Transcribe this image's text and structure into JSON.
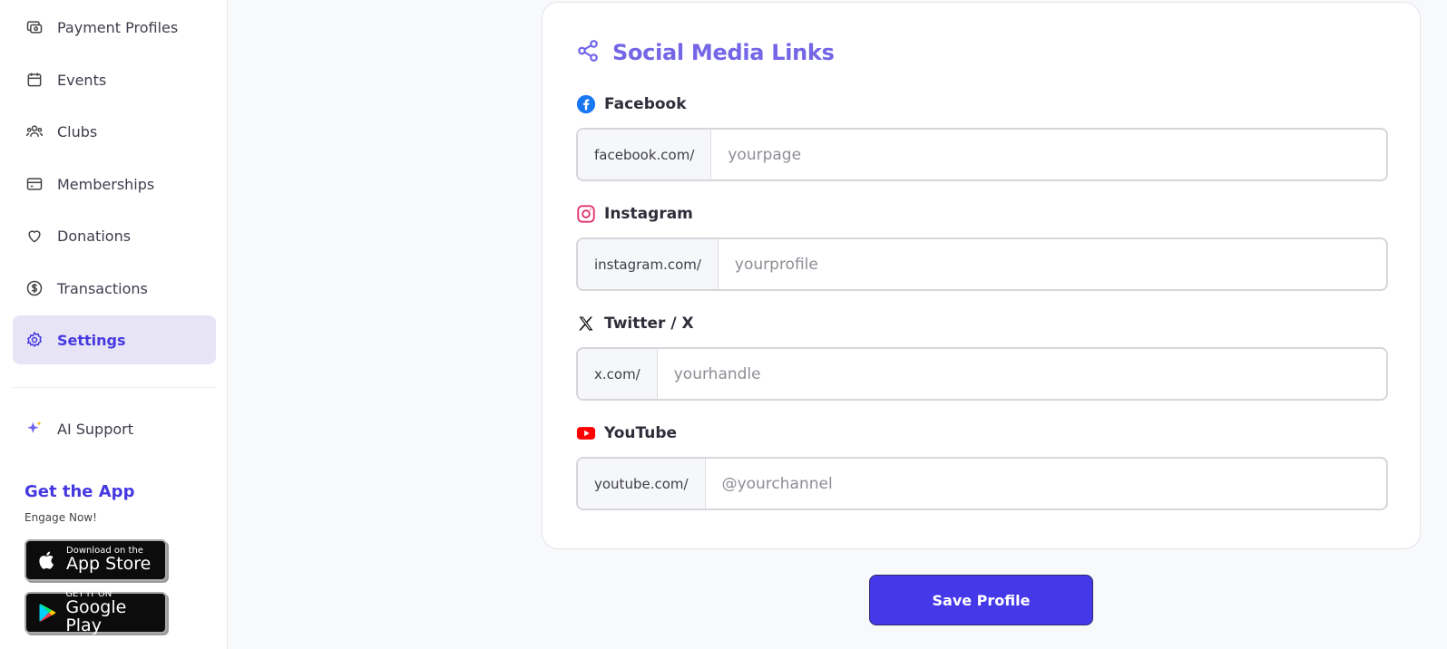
{
  "sidebar": {
    "items": [
      {
        "label": "Payment Profiles",
        "icon": "payment-icon"
      },
      {
        "label": "Events",
        "icon": "calendar-icon"
      },
      {
        "label": "Clubs",
        "icon": "users-icon"
      },
      {
        "label": "Memberships",
        "icon": "card-icon"
      },
      {
        "label": "Donations",
        "icon": "heart-icon"
      },
      {
        "label": "Transactions",
        "icon": "dollar-circle-icon"
      },
      {
        "label": "Settings",
        "icon": "gear-icon",
        "active": true
      }
    ],
    "ai_support": {
      "label": "AI Support",
      "icon": "sparkle-icon"
    },
    "get_app": {
      "title": "Get the App",
      "subtitle": "Engage Now!",
      "app_store": {
        "small": "Download on the",
        "big": "App Store"
      },
      "google_play": {
        "small": "GET IT ON",
        "big": "Google Play"
      }
    }
  },
  "social": {
    "title": "Social Media Links",
    "fields": [
      {
        "label": "Facebook",
        "prefix": "facebook.com/",
        "placeholder": "yourpage",
        "value": ""
      },
      {
        "label": "Instagram",
        "prefix": "instagram.com/",
        "placeholder": "yourprofile",
        "value": ""
      },
      {
        "label": "Twitter / X",
        "prefix": "x.com/",
        "placeholder": "yourhandle",
        "value": ""
      },
      {
        "label": "YouTube",
        "prefix": "youtube.com/",
        "placeholder": "@yourchannel",
        "value": ""
      }
    ]
  },
  "save_label": "Save Profile",
  "colors": {
    "accent": "#4538e8",
    "title": "#7466e6",
    "active_bg": "#e7e5f5",
    "facebook": "#1877f2",
    "instagram": "#e1306c",
    "youtube": "#ff0000"
  }
}
